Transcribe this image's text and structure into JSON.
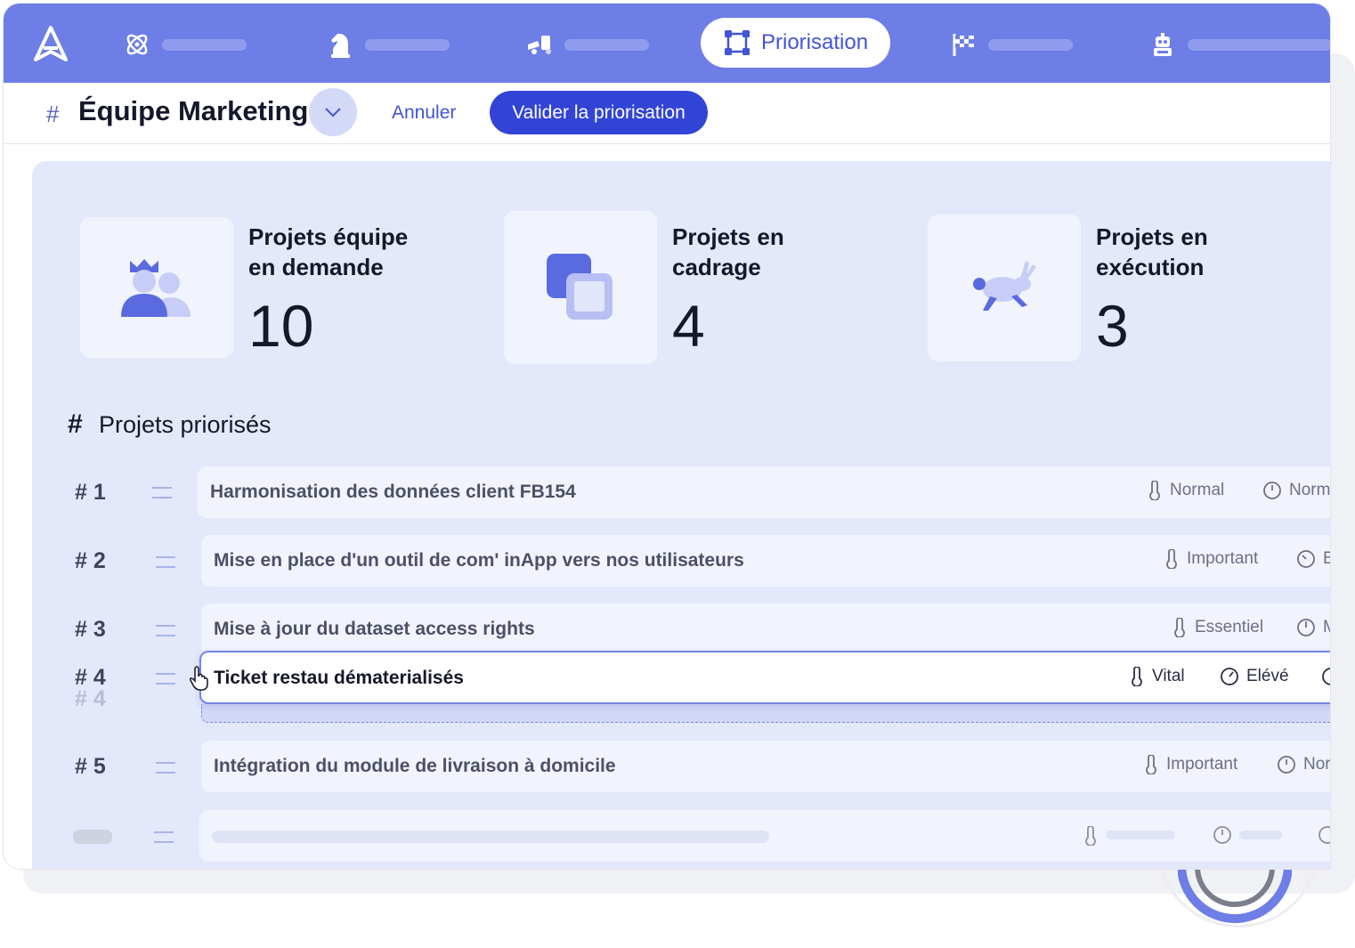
{
  "nav": {
    "active_label": "Priorisation",
    "items": [
      {
        "icon": "atom-icon"
      },
      {
        "icon": "chess-knight-icon"
      },
      {
        "icon": "truck-icon"
      },
      {
        "icon": "priorisation-icon"
      },
      {
        "icon": "flag-icon"
      },
      {
        "icon": "robot-icon"
      }
    ]
  },
  "header": {
    "hash": "#",
    "team": "Équipe Marketing",
    "cancel": "Annuler",
    "validate": "Valider la priorisation"
  },
  "stats": [
    {
      "title_line1": "Projets équipe",
      "title_line2": "en demande",
      "value": "10",
      "icon": "team-icon"
    },
    {
      "title_line1": "Projets en",
      "title_line2": "cadrage",
      "value": "4",
      "icon": "layers-icon"
    },
    {
      "title_line1": "Projets en",
      "title_line2": "exécution",
      "value": "3",
      "icon": "rabbit-icon"
    }
  ],
  "section": {
    "hash": "#",
    "title": "Projets priorisés"
  },
  "projects": [
    {
      "rank": "# 1",
      "title": "Harmonisation des données client FB154",
      "priority": "Normal",
      "effort": "Norma"
    },
    {
      "rank": "# 2",
      "title": "Mise en place d'un outil de com' inApp vers nos utilisateurs",
      "priority": "Important",
      "effort": "B"
    },
    {
      "rank": "# 3",
      "title": "Mise à jour du dataset access rights",
      "priority": "Essentiel",
      "effort": "M"
    },
    {
      "rank": "# 4",
      "title": "Ticket restau dématerialisés",
      "priority": "Vital",
      "effort": "Elévé"
    },
    {
      "rank": "# 5",
      "title": "Intégration du module de livraison à domicile",
      "priority": "Important",
      "effort": "Nor"
    }
  ],
  "ghost_rank": "# 4",
  "colors": {
    "brand": "#6d7ee6",
    "accent": "#3244d6",
    "panel": "#e4e8fb"
  }
}
